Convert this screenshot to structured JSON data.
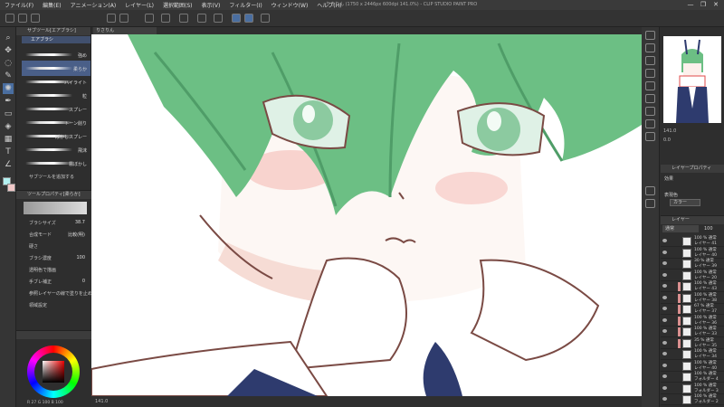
{
  "app": {
    "title": "りさりん (1750 x 2446px 600dpi 141.0%) - CLIP STUDIO PAINT PRO",
    "menu": [
      "ファイル(F)",
      "編集(E)",
      "アニメーション(A)",
      "レイヤー(L)",
      "選択範囲(S)",
      "表示(V)",
      "フィルター(I)",
      "ウィンドウ(W)",
      "ヘルプ(H)"
    ],
    "window_buttons": [
      "—",
      "❐",
      "✕"
    ]
  },
  "sub_tool": {
    "panel_title": "サブツール[エアブラシ]",
    "group": "エアブラシ",
    "brushes": [
      {
        "label": "強め",
        "selected": false
      },
      {
        "label": "柔らか",
        "selected": true
      },
      {
        "label": "ハイライト",
        "selected": false
      },
      {
        "label": "粒",
        "selected": false
      },
      {
        "label": "スプレー",
        "selected": false
      },
      {
        "label": "トーン削り",
        "selected": false
      },
      {
        "label": "ぼかしスプレー",
        "selected": false
      },
      {
        "label": "飛沫",
        "selected": false
      },
      {
        "label": "霧ぼかし",
        "selected": false
      }
    ],
    "add_button": "サブツールを追加する"
  },
  "tool_property": {
    "panel_title": "ツールプロパティ[柔らか]",
    "rows": [
      {
        "label": "ブラシサイズ",
        "value": "38.7"
      },
      {
        "label": "合成モード",
        "value": "比較(明)"
      },
      {
        "label": "硬さ",
        "value": ""
      },
      {
        "label": "ブラシ濃度",
        "value": "100"
      },
      {
        "label": "透明色で描画",
        "value": ""
      },
      {
        "label": "手ブレ補正",
        "value": "0"
      },
      {
        "label": "参照レイヤーの線で塗りを止める",
        "value": ""
      },
      {
        "label": "領域設定",
        "value": ""
      }
    ]
  },
  "color": {
    "main": "#b3f0f0",
    "sub": "#f0c8c8",
    "readout": "R 27 G 100 B 100"
  },
  "canvas": {
    "tab_label": "りさりん",
    "status": "141.0"
  },
  "navigator": {
    "zoom": "141.0",
    "rotation": "0.0"
  },
  "layer_property": {
    "title": "レイヤープロパティ",
    "effect_label": "効果",
    "color_label": "表現色",
    "color_value": "カラー"
  },
  "layers": {
    "title": "レイヤー",
    "blend": "通常",
    "opacity": "100",
    "rows": [
      {
        "pct": "100 % 通常",
        "name": "レイヤー 41",
        "marked": false
      },
      {
        "pct": "100 % 通常",
        "name": "レイヤー 40",
        "marked": false
      },
      {
        "pct": "30 % 通常",
        "name": "レイヤー 39",
        "marked": false
      },
      {
        "pct": "100 % 通常",
        "name": "レイヤー 20",
        "marked": false
      },
      {
        "pct": "100 % 通常",
        "name": "レイヤー 43",
        "marked": true
      },
      {
        "pct": "100 % 通常",
        "name": "レイヤー 38",
        "marked": true
      },
      {
        "pct": "67 % 通常",
        "name": "レイヤー 37",
        "marked": true
      },
      {
        "pct": "100 % 通常",
        "name": "レイヤー 36",
        "marked": true
      },
      {
        "pct": "100 % 通常",
        "name": "レイヤー 33",
        "marked": true
      },
      {
        "pct": "35 % 通常",
        "name": "レイヤー 35",
        "marked": true
      },
      {
        "pct": "100 % 通常",
        "name": "レイヤー 34",
        "marked": false
      },
      {
        "pct": "100 % 通常",
        "name": "レイヤー 40",
        "marked": false
      },
      {
        "pct": "100 % 通常",
        "name": "フォルダー 4",
        "marked": false
      },
      {
        "pct": "100 % 通常",
        "name": "フォルダー 3",
        "marked": false
      },
      {
        "pct": "100 % 通常",
        "name": "フォルダー 2",
        "marked": false
      }
    ]
  }
}
